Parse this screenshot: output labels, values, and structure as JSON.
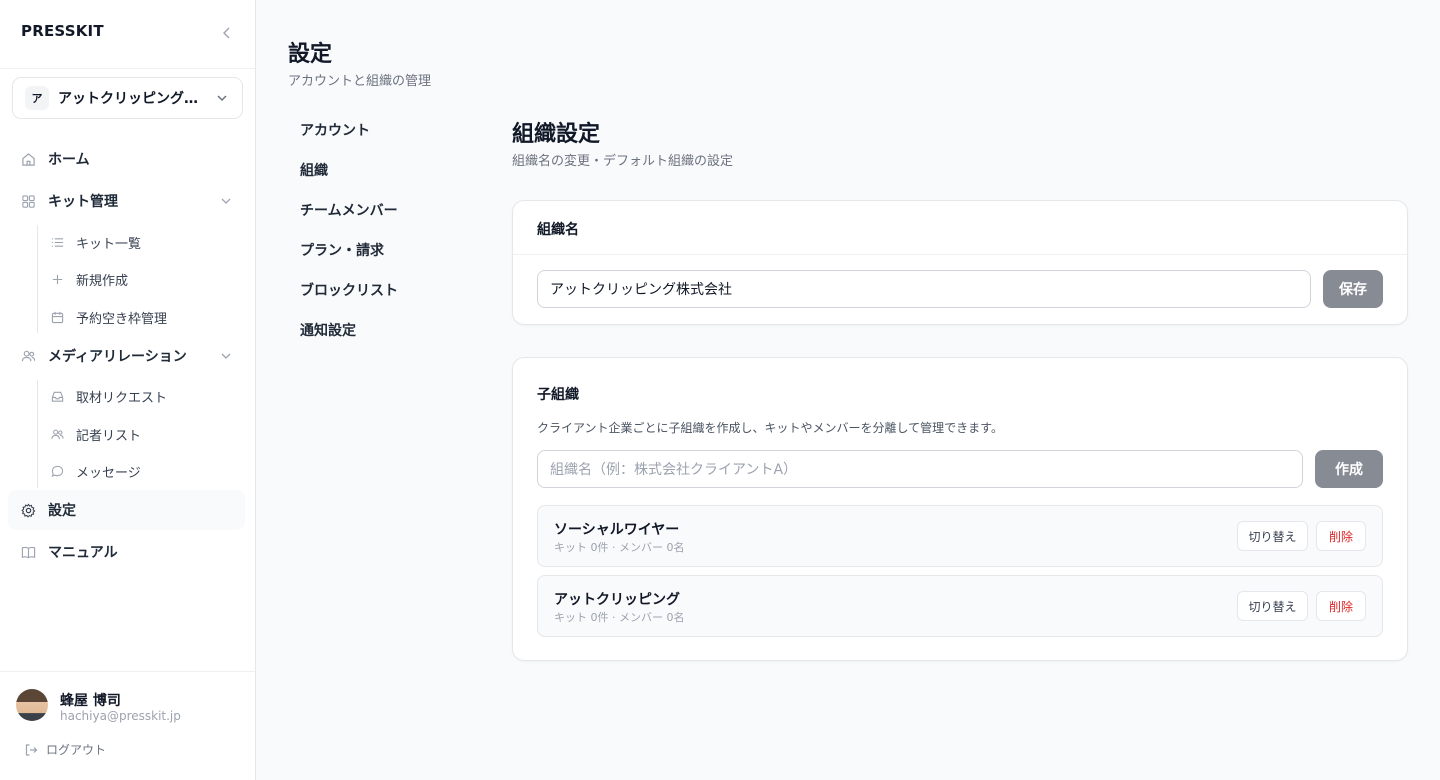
{
  "sidebar": {
    "brand": "PRESSKIT",
    "org": {
      "initial": "ア",
      "name": "アットクリッピング株式会社"
    },
    "nav": {
      "home": "ホーム",
      "kit": "キット管理",
      "kit_list": "キット一覧",
      "kit_new": "新規作成",
      "kit_slots": "予約空き枠管理",
      "media": "メディアリレーション",
      "requests": "取材リクエスト",
      "journalists": "記者リスト",
      "messages": "メッセージ",
      "settings": "設定",
      "manual": "マニュアル"
    },
    "user": {
      "name": "蜂屋 博司",
      "email": "hachiya@presskit.jp"
    },
    "logout": "ログアウト"
  },
  "page": {
    "title": "設定",
    "subtitle": "アカウントと組織の管理"
  },
  "subnav": [
    "アカウント",
    "組織",
    "チームメンバー",
    "プラン・請求",
    "ブロックリスト",
    "通知設定"
  ],
  "section": {
    "title": "組織設定",
    "subtitle": "組織名の変更・デフォルト組織の設定"
  },
  "org_name_card": {
    "heading": "組織名",
    "value": "アットクリッピング株式会社",
    "save_label": "保存"
  },
  "child_orgs_card": {
    "heading": "子組織",
    "description": "クライアント企業ごとに子組織を作成し、キットやメンバーを分離して管理できます。",
    "placeholder": "組織名（例：株式会社クライアントA）",
    "create_label": "作成",
    "switch_label": "切り替え",
    "delete_label": "削除",
    "items": [
      {
        "name": "ソーシャルワイヤー",
        "meta": "キット 0件 · メンバー 0名"
      },
      {
        "name": "アットクリッピング",
        "meta": "キット 0件 · メンバー 0名"
      }
    ]
  },
  "colors": {
    "accent_gray": "#878b94",
    "danger": "#dc2626"
  }
}
